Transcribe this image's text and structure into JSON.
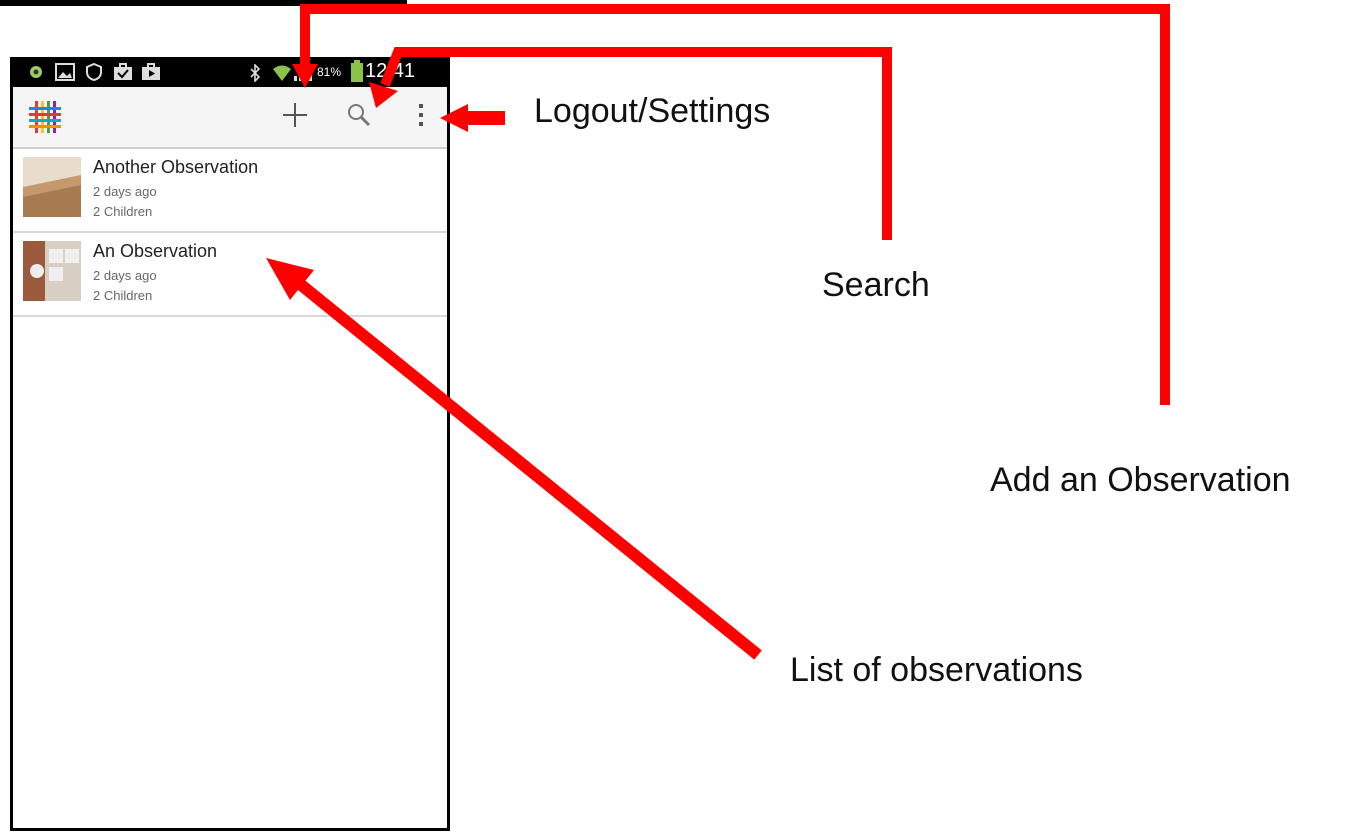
{
  "status_bar": {
    "battery_percent": "81%",
    "time": "12:41",
    "icons": [
      "pinwheel-icon",
      "image-icon",
      "shield-icon",
      "briefcase-check-icon",
      "play-store-icon",
      "bluetooth-icon",
      "wifi-icon",
      "signal-icon",
      "battery-icon"
    ]
  },
  "action_bar": {
    "logo_icon": "grid-weave-logo",
    "add_icon": "plus-icon",
    "search_icon": "search-icon",
    "overflow_icon": "overflow-menu-icon"
  },
  "observations": [
    {
      "title": "Another Observation",
      "time": "2 days ago",
      "children": "2 Children"
    },
    {
      "title": "An Observation",
      "time": "2 days ago",
      "children": "2 Children"
    }
  ],
  "annotations": {
    "logout": "Logout/Settings",
    "search": "Search",
    "add": "Add an Observation",
    "list": "List of observations",
    "arrow_color": "#ff0000"
  }
}
